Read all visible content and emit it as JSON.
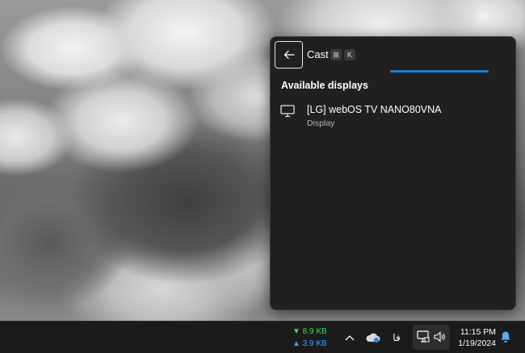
{
  "flyout": {
    "title": "Cast",
    "shortcut_keys": [
      "⊞",
      "K"
    ],
    "section_title": "Available displays",
    "devices": [
      {
        "name": "[LG] webOS TV NANO80VNA",
        "type": "Display",
        "icon": "monitor-icon"
      }
    ],
    "accent_color": "#1a7fd6"
  },
  "taskbar": {
    "net_down": "▼ 8.9 KB",
    "net_up": "▲ 3.9 KB",
    "ime": "فا",
    "time": "11:15 PM",
    "date": "1/19/2024",
    "icons": [
      "chevron-up-icon",
      "onedrive-cloud-icon",
      "cast-monitor-icon",
      "speaker-icon",
      "notification-bell-icon"
    ]
  }
}
